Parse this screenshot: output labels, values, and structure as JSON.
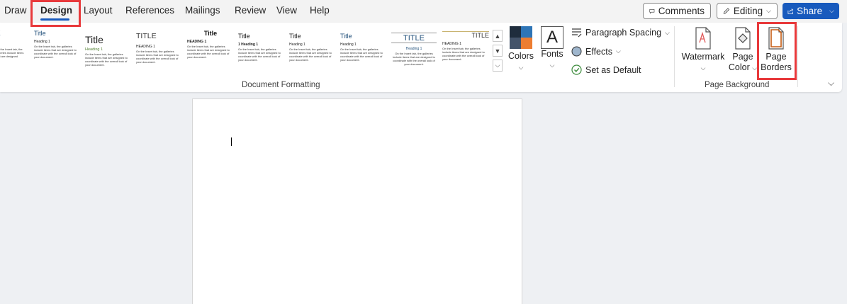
{
  "tabs": [
    {
      "label": "Draw"
    },
    {
      "label": "Design"
    },
    {
      "label": "Layout"
    },
    {
      "label": "References"
    },
    {
      "label": "Mailings"
    },
    {
      "label": "Review"
    },
    {
      "label": "View"
    },
    {
      "label": "Help"
    }
  ],
  "active_tab": "Design",
  "header_buttons": {
    "comments": "Comments",
    "editing": "Editing",
    "share": "Share"
  },
  "style_gallery": [
    {
      "title": "E",
      "heading": "",
      "body": ""
    },
    {
      "title": "Title",
      "heading": "Heading 1",
      "body": "On the Insert tab, the galleries include items that are designed to coordinate with the overall look of your document."
    },
    {
      "title": "Title",
      "heading": "Heading 1",
      "body": "On the Insert tab, the galleries include items that are designed to coordinate with the overall look of your document."
    },
    {
      "title": "TITLE",
      "heading": "HEADING 1",
      "body": "On the Insert tab, the galleries include items that are designed to coordinate with the overall look of your document."
    },
    {
      "title": "Title",
      "heading": "HEADING 1",
      "body": "On the Insert tab, the galleries include items that are designed to coordinate with the overall look of your document."
    },
    {
      "title": "Title",
      "heading": "1  Heading 1",
      "body": "On the Insert tab, the galleries include items that are designed to coordinate with the overall look of your document."
    },
    {
      "title": "Title",
      "heading": "Heading 1",
      "body": "On the Insert tab, the galleries include items that are designed to coordinate with the overall look of your document."
    },
    {
      "title": "Title",
      "heading": "Heading 1",
      "body": "On the Insert tab, the galleries include items that are designed to coordinate with the overall look of your document."
    },
    {
      "title": "TITLE",
      "heading": "Heading 1",
      "body": "On the Insert tab, the galleries include items that are designed to coordinate with the overall look of your document."
    },
    {
      "title": "TITLE",
      "heading": "HEADING 1",
      "body": "On the Insert tab, the galleries include items that are designed to coordinate with the overall look of your document."
    }
  ],
  "ribbon": {
    "colors_label": "Colors",
    "fonts_label": "Fonts",
    "fonts_glyph": "A",
    "paragraph_spacing_label": "Paragraph Spacing",
    "effects_label": "Effects",
    "set_default_label": "Set as Default",
    "watermark_label": "Watermark",
    "page_color_line1": "Page",
    "page_color_line2": "Color",
    "page_borders_line1": "Page",
    "page_borders_line2": "Borders",
    "group_document_formatting": "Document Formatting",
    "group_page_background": "Page Background"
  },
  "theme_colors": {
    "accent": "#185abd",
    "highlight": "#e8393b",
    "swatch_dark": "#1f2d3d",
    "swatch_blue": "#2e75b6",
    "swatch_teal": "#44546a",
    "swatch_orange": "#ed7d31"
  }
}
